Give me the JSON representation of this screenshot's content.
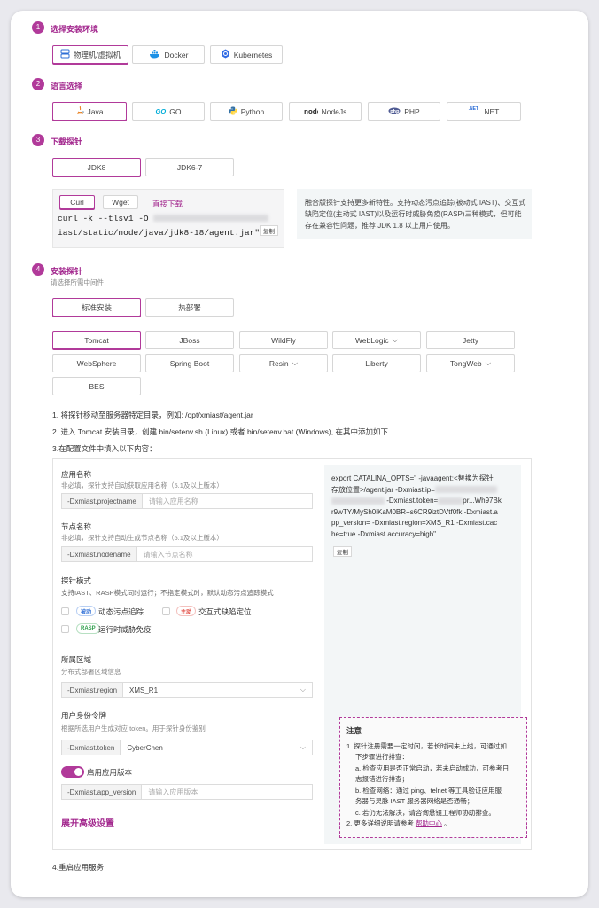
{
  "steps": {
    "env": {
      "num": "1",
      "title": "选择安装环境",
      "options": [
        "物理机/虚拟机",
        "Docker",
        "Kubernetes"
      ]
    },
    "lang": {
      "num": "2",
      "title": "语言选择",
      "options": [
        "Java",
        "GO",
        "Python",
        "NodeJs",
        "PHP",
        ".NET"
      ],
      "go_logo": "GO",
      "net_logo": ".NET"
    },
    "download": {
      "num": "3",
      "title": "下载探针",
      "jdk_options": [
        "JDK8",
        "JDK6-7"
      ],
      "tools": [
        "Curl",
        "Wget"
      ],
      "direct_link": "直接下载",
      "cmd_line1": "curl -k --tlsv1 -O",
      "cmd_line2": "iast/static/node/java/jdk8-18/agent.jar\"",
      "copy_label": "复制",
      "info": "融合版探针支持更多新特性。支持动态污点追踪(被动式 IAST)、交互式缺陷定位(主动式 IAST)以及运行时威胁免疫(RASP)三种模式，但可能存在兼容性问题，推荐 JDK 1.8 以上用户使用。"
    },
    "install": {
      "num": "4",
      "title": "安装探针",
      "subtitle": "请选择所需中间件",
      "modes": [
        "标准安装",
        "热部署"
      ],
      "middleware_row1": [
        "Tomcat",
        "JBoss",
        "WildFly",
        "WebLogic",
        "Jetty"
      ],
      "middleware_row2": [
        "WebSphere",
        "Spring Boot",
        "Resin",
        "Liberty",
        "TongWeb"
      ],
      "middleware_row3": [
        "BES"
      ],
      "instruction1": "1. 将探针移动至服务器特定目录，例如: /opt/xmiast/agent.jar",
      "instruction2": "2. 进入 Tomcat 安装目录，创建 bin/setenv.sh (Linux) 或者 bin/setenv.bat (Windows), 在其中添加如下",
      "instruction3": "3.在配置文件中填入以下内容：",
      "instruction4": "4.重启应用服务"
    }
  },
  "form": {
    "app_name": {
      "label": "应用名称",
      "desc": "非必填，探针支持自动获取应用名称（5.1及以上版本）",
      "prefix": "-Dxmiast.projectname",
      "placeholder": "请输入应用名称"
    },
    "node_name": {
      "label": "节点名称",
      "desc": "非必填，探针支持自动生成节点名称（5.1及以上版本）",
      "prefix": "-Dxmiast.nodename",
      "placeholder": "请输入节点名称"
    },
    "probe_mode": {
      "label": "探针模式",
      "desc": "支持IAST、RASP模式同时运行；不指定模式时，默认动态污点追踪模式",
      "opt1": {
        "badge": "被动",
        "text": "动态污点追踪"
      },
      "opt2": {
        "badge": "主动",
        "text": "交互式缺陷定位"
      },
      "opt3": {
        "badge": "RASP",
        "text": "运行时威胁免疫"
      }
    },
    "region": {
      "label": "所属区域",
      "desc": "分布式部署区域信息",
      "prefix": "-Dxmiast.region",
      "value": "XMS_R1"
    },
    "token": {
      "label": "用户身份令牌",
      "desc": "根据所选用户生成对应 token。用于探针身份鉴别",
      "prefix": "-Dxmiast.token",
      "value": "CyberChen"
    },
    "version": {
      "toggle_label": "启用应用版本",
      "prefix": "-Dxmiast.app_version",
      "placeholder": "请输入应用版本"
    },
    "advanced": "展开高级设置"
  },
  "config_code": {
    "line1": "export CATALINA_OPTS=\" -javaagent:<替换为探针",
    "line2": "存放位置>/agent.jar -Dxmiast.ip=",
    "line3": "-Dxmiast.token=",
    "line3b": "pr...Wh97Bk",
    "line4": "r9wTY/MySh0iKaM0BR+s6CR9iztDVtf0fk -Dxmiast.a",
    "line5": "pp_version= -Dxmiast.region=XMS_R1 -Dxmiast.cac",
    "line6": "he=true -Dxmiast.accuracy=high\"",
    "copy_label": "复制"
  },
  "notes": {
    "title": "注意",
    "l1": "1. 探针注册需要一定时间，若长时间未上线，可通过如",
    "l1b": "下步骤进行排查：",
    "l2": "a. 检查应用是否正常启动，若未启动成功，可参考日",
    "l2b": "志报错进行排查；",
    "l3": "b. 检查网络：通过 ping、telnet 等工具验证应用服",
    "l3b": "务器与灵脉 IAST 服务器网络是否通畅；",
    "l4": "c. 若仍无法解决，请咨询悬镜工程师协助排查。",
    "l5": "2. 更多详细说明请参考",
    "help": "帮助中心",
    "l5end": "。"
  }
}
